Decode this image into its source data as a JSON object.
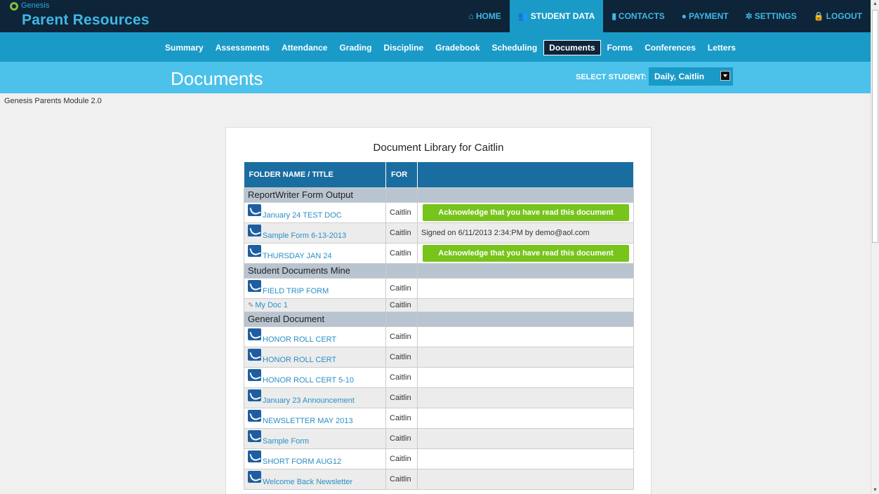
{
  "brand": {
    "small": "Genesis",
    "title": "Parent Resources"
  },
  "topnav": [
    {
      "label": "HOME",
      "icon": "home-icon",
      "glyph": "⌂",
      "active": false
    },
    {
      "label": "STUDENT DATA",
      "icon": "users-icon",
      "glyph": "👥",
      "active": true
    },
    {
      "label": "CONTACTS",
      "icon": "contacts-icon",
      "glyph": "▮",
      "active": false
    },
    {
      "label": "PAYMENT",
      "icon": "payment-icon",
      "glyph": "●",
      "active": false
    },
    {
      "label": "SETTINGS",
      "icon": "gear-icon",
      "glyph": "✲",
      "active": false
    },
    {
      "label": "LOGOUT",
      "icon": "lock-icon",
      "glyph": "🔒",
      "active": false
    }
  ],
  "subnav": [
    "Summary",
    "Assessments",
    "Attendance",
    "Grading",
    "Discipline",
    "Gradebook",
    "Scheduling",
    "Documents",
    "Forms",
    "Conferences",
    "Letters"
  ],
  "subnav_active": "Documents",
  "page": {
    "title": "Documents",
    "select_label": "SELECT STUDENT:",
    "selected_student": "Daily, Caitlin",
    "module": "Genesis Parents Module 2.0"
  },
  "library": {
    "title": "Document Library for Caitlin",
    "headers": [
      "FOLDER NAME / TITLE",
      "FOR",
      ""
    ],
    "folders": [
      {
        "name": "ReportWriter Form Output",
        "docs": [
          {
            "title": "January 24 TEST DOC",
            "for": "Caitlin",
            "action": "Acknowledge that you have read this document",
            "type": "pdf"
          },
          {
            "title": "Sample Form 6-13-2013",
            "for": "Caitlin",
            "status": "Signed on 6/11/2013 2:34:PM by demo@aol.com",
            "type": "pdf"
          },
          {
            "title": "THURSDAY JAN 24",
            "for": "Caitlin",
            "action": "Acknowledge that you have read this document",
            "type": "pdf"
          }
        ]
      },
      {
        "name": "Student Documents Mine",
        "docs": [
          {
            "title": "FIELD TRIP FORM",
            "for": "Caitlin",
            "type": "pdf"
          },
          {
            "title": "My Doc 1",
            "for": "Caitlin",
            "type": "attachment"
          }
        ]
      },
      {
        "name": "General Document",
        "docs": [
          {
            "title": "HONOR ROLL CERT",
            "for": "Caitlin",
            "type": "pdf"
          },
          {
            "title": "HONOR ROLL CERT",
            "for": "Caitlin",
            "type": "pdf"
          },
          {
            "title": "HONOR ROLL CERT 5-10",
            "for": "Caitlin",
            "type": "pdf"
          },
          {
            "title": "January 23 Announcement",
            "for": "Caitlin",
            "type": "pdf"
          },
          {
            "title": "NEWSLETTER MAY 2013",
            "for": "Caitlin",
            "type": "pdf"
          },
          {
            "title": "Sample Form",
            "for": "Caitlin",
            "type": "pdf"
          },
          {
            "title": "SHORT FORM AUG12",
            "for": "Caitlin",
            "type": "pdf"
          },
          {
            "title": "Welcome Back Newsletter",
            "for": "Caitlin",
            "type": "pdf"
          }
        ]
      }
    ]
  },
  "colors": {
    "topbar": "#0e2438",
    "subnav": "#1a9ac7",
    "header": "#4cc1ea",
    "table_head": "#1a6da0",
    "ack_button": "#77c41b",
    "folder_row": "#b8c4cf"
  }
}
